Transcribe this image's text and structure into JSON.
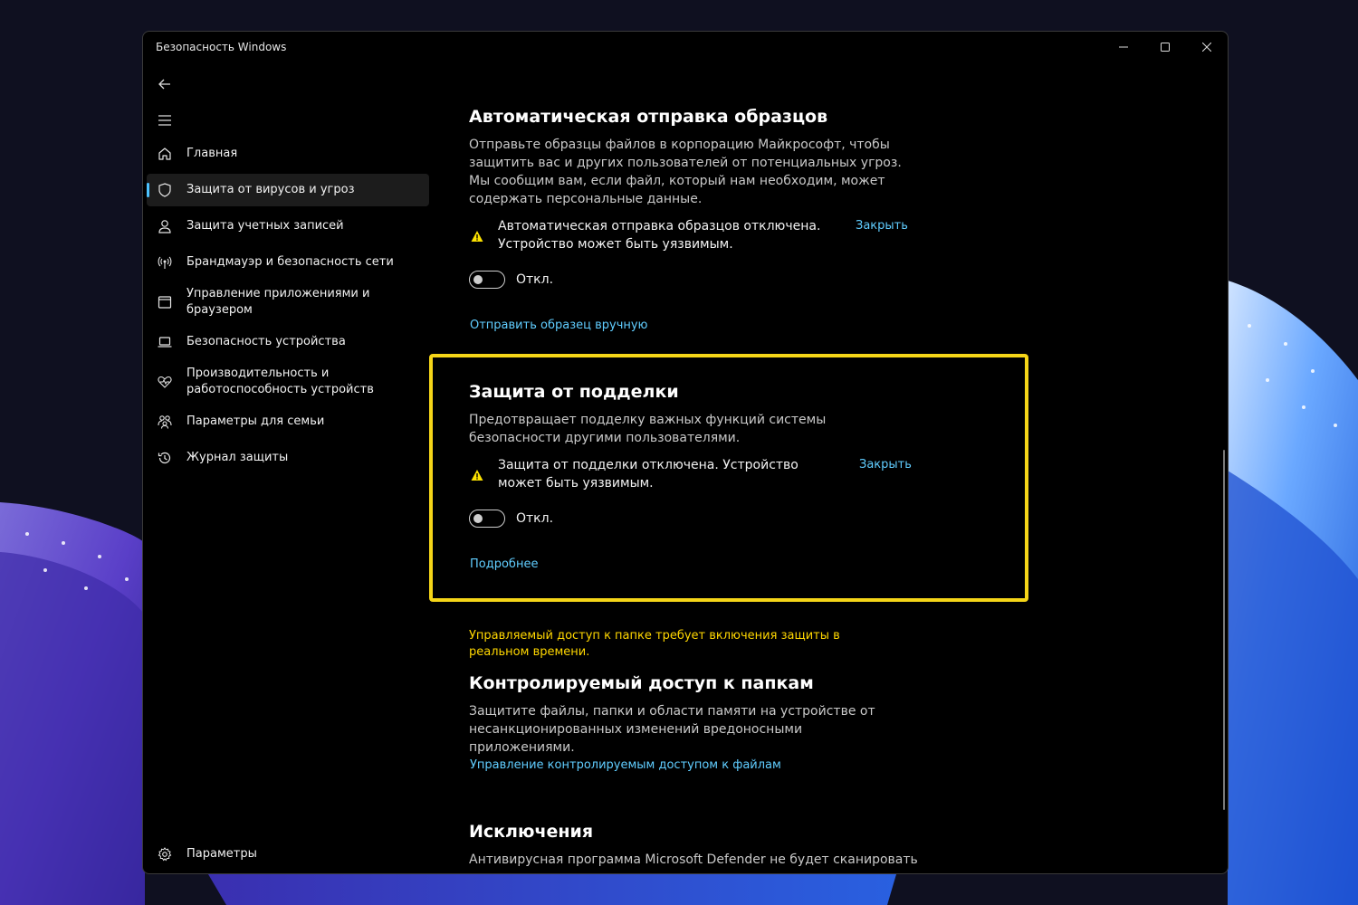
{
  "window": {
    "title": "Безопасность Windows"
  },
  "nav": {
    "items": [
      {
        "label": "Главная",
        "icon": "home-icon"
      },
      {
        "label": "Защита от вирусов и угроз",
        "icon": "shield-icon",
        "active": true
      },
      {
        "label": "Защита учетных записей",
        "icon": "person-icon"
      },
      {
        "label": "Брандмауэр и безопасность сети",
        "icon": "antenna-icon"
      },
      {
        "label": "Управление приложениями и браузером",
        "icon": "app-window-icon"
      },
      {
        "label": "Безопасность устройства",
        "icon": "laptop-icon"
      },
      {
        "label": "Производительность и работоспособность устройств",
        "icon": "heart-pulse-icon"
      },
      {
        "label": "Параметры для семьи",
        "icon": "family-icon"
      },
      {
        "label": "Журнал защиты",
        "icon": "history-icon"
      }
    ],
    "settings_label": "Параметры"
  },
  "sample_submission": {
    "title": "Автоматическая отправка образцов",
    "description": "Отправьте образцы файлов в корпорацию Майкрософт, чтобы защитить вас и других пользователей от потенциальных угроз. Мы сообщим вам, если файл, который нам необходим, может содержать персональные данные.",
    "warning": "Автоматическая отправка образцов отключена. Устройство может быть уязвимым.",
    "dismiss": "Закрыть",
    "toggle_label": "Откл.",
    "toggle_on": false,
    "manual_link": "Отправить образец вручную"
  },
  "tamper_protection": {
    "title": "Защита от подделки",
    "description": "Предотвращает подделку важных функций системы безопасности другими пользователями.",
    "warning": "Защита от подделки отключена. Устройство может быть уязвимым.",
    "dismiss": "Закрыть",
    "toggle_label": "Откл.",
    "toggle_on": false,
    "more_link": "Подробнее"
  },
  "folder_access": {
    "notice": "Управляемый доступ к папке требует включения защиты в реальном времени.",
    "title": "Контролируемый доступ к папкам",
    "description": "Защитите файлы, папки и области памяти на устройстве от несанкционированных изменений вредоносными приложениями.",
    "manage_link": "Управление контролируемым доступом к файлам"
  },
  "exclusions": {
    "title": "Исключения",
    "description": "Антивирусная программа Microsoft Defender не будет сканировать"
  },
  "colors": {
    "accent": "#60cdff",
    "highlight": "#f5d518",
    "notice": "#ffd700",
    "warning": "#fce100"
  }
}
